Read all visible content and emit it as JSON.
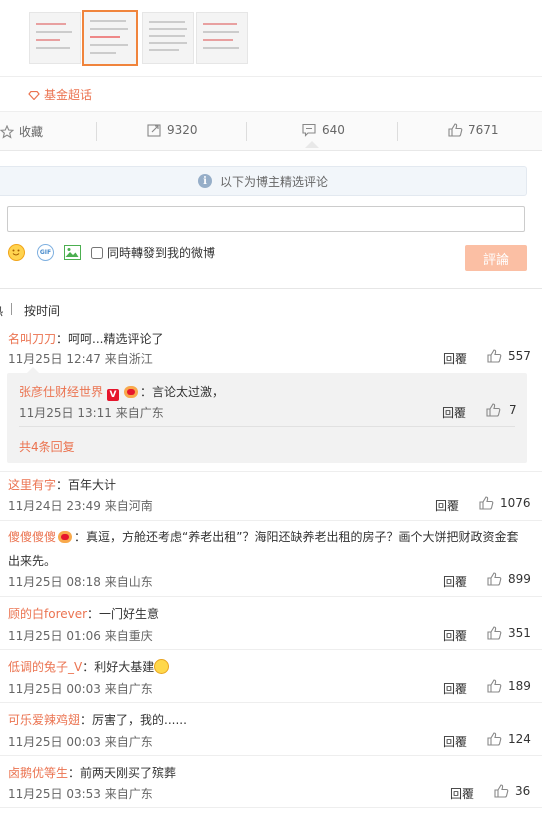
{
  "topic_tag": "基金超话",
  "actions": {
    "favorite": "收藏",
    "repost_count": "9320",
    "comment_count": "640",
    "like_count": "7671"
  },
  "notice": "以下为博主精选评论",
  "compose": {
    "input_value": "",
    "checkbox_label": "同時轉發到我的微博",
    "submit": "評論"
  },
  "sort": {
    "left": "热",
    "right": "按时间"
  },
  "comments": [
    {
      "user": "名叫刀刀",
      "text": "：呵呵...精选评论了",
      "time": "11月25日 12:47 来自浙江",
      "reply": "回覆",
      "likes": "557"
    },
    {
      "user": "这里有字",
      "text": "：百年大计",
      "time": "11月24日 23:49 来自河南",
      "reply": "回覆",
      "likes": "1076"
    },
    {
      "user": "傻傻傻傻",
      "text": "：真逗，方舱还考虑“养老出租”？海阳还缺养老出租的房子？画个大饼把财政资金套",
      "text2": "出来先。",
      "time": "11月25日 08:18 来自山东",
      "reply": "回覆",
      "likes": "899"
    },
    {
      "user": "顾的白forever",
      "text": "：一门好生意",
      "time": "11月25日 01:06 来自重庆",
      "reply": "回覆",
      "likes": "351"
    },
    {
      "user": "低调的兔子_V",
      "text": "：利好大基建",
      "time": "11月25日 00:03 来自广东",
      "reply": "回覆",
      "likes": "189"
    },
    {
      "user": "可乐爱辣鸡翅",
      "text": "：厉害了，我的......",
      "time": "11月25日 00:03 来自广东",
      "reply": "回覆",
      "likes": "124"
    },
    {
      "user": "卤鹅优等生",
      "text": "：前两天刚买了殡葬",
      "time": "11月25日 03:53 来自广东",
      "reply": "回覆",
      "likes": "36"
    }
  ],
  "sub_reply": {
    "user": "张彦仕财经世界",
    "text": "：言论太过激，",
    "time": "11月25日 13:11 来自广东",
    "reply": "回覆",
    "likes": "7",
    "more": "共4条回复"
  }
}
